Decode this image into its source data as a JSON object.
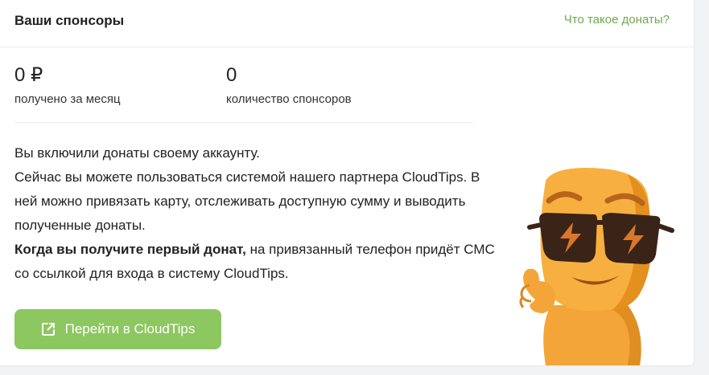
{
  "header": {
    "title": "Ваши спонсоры",
    "help_link": "Что такое донаты?"
  },
  "stats": [
    {
      "value": "0 ₽",
      "label": "получено за месяц"
    },
    {
      "value": "0",
      "label": "количество спонсоров"
    }
  ],
  "description": {
    "line1": "Вы включили донаты своему аккаунту.",
    "line2": "Сейчас вы можете пользоваться системой нашего партнера CloudTips. В ней можно привязать карту, отслеживать доступную сумму и выводить полученные донаты.",
    "bold": "Когда вы получите первый донат,",
    "rest": " на привязанный телефон придёт СМС со ссылкой для входа в систему CloudTips."
  },
  "cta": {
    "label": "Перейти в CloudTips",
    "icon": "external-link-icon"
  },
  "colors": {
    "accent_green": "#8dc75f",
    "link_green": "#6fa84f",
    "mascot_orange": "#f5a93b"
  }
}
